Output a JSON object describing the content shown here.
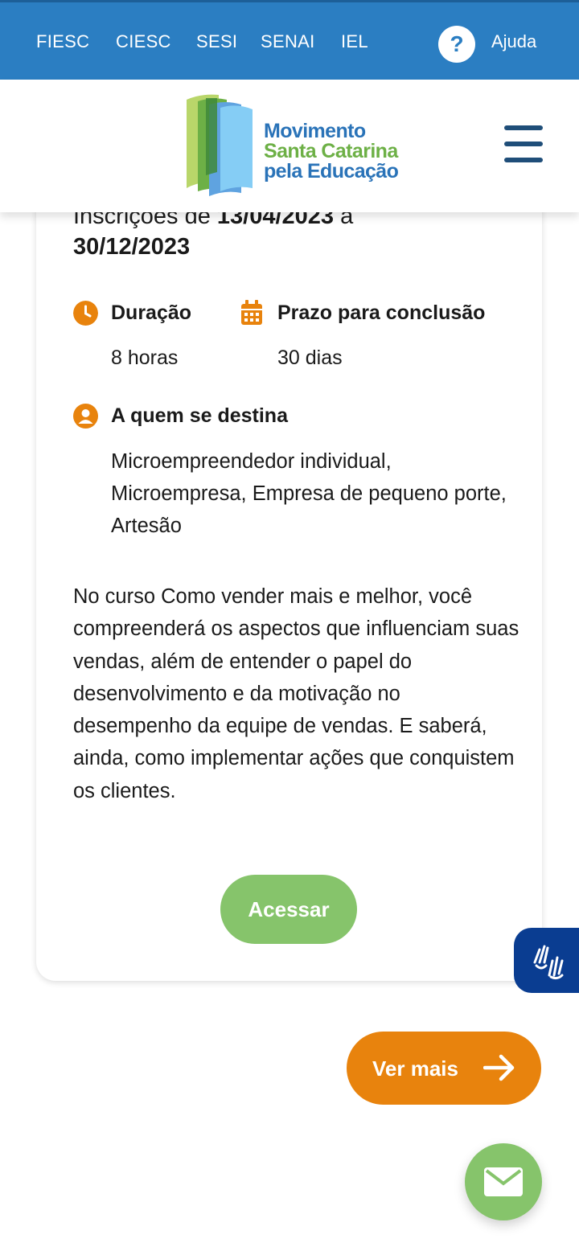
{
  "topbar": {
    "links": [
      "FIESC",
      "CIESC",
      "SESI",
      "SENAI",
      "IEL"
    ],
    "help_icon": "?",
    "help_label": "Ajuda"
  },
  "logo": {
    "line1": "Movimento",
    "line2": "Santa Catarina",
    "line3": "pela Educação"
  },
  "card": {
    "inscricoes_prefix": "Inscrições de ",
    "inscricoes_start": "13/04/2023",
    "inscricoes_sep": " a ",
    "inscricoes_end": "30/12/2023",
    "duracao_label": "Duração",
    "duracao_value": "8 horas",
    "prazo_label": "Prazo para conclusão",
    "prazo_value": "30 dias",
    "publico_label": "A quem se destina",
    "publico_value": "Microempreendedor individual, Microempresa, Empresa de pequeno porte, Artesão",
    "description": "No curso Como vender mais e melhor, você compreenderá os aspectos que influenciam suas vendas, além de entender o papel do desenvolvimento e da motivação no desempenho da equipe de vendas. E saberá, ainda, como implementar ações que conquistem os clientes.",
    "access_button": "Acessar"
  },
  "ver_mais_button": "Ver mais",
  "colors": {
    "topbar": "#2b7ec2",
    "accent_orange": "#e8830d",
    "accent_green": "#86c46b",
    "libras_blue": "#0a3d91"
  },
  "icons": {
    "help": "question-icon",
    "menu": "hamburger-menu-icon",
    "duration": "clock-icon",
    "deadline": "calendar-icon",
    "audience": "user-icon",
    "libras": "sign-language-hands-icon",
    "ver_mais": "arrow-right-icon",
    "mail": "envelope-icon"
  }
}
